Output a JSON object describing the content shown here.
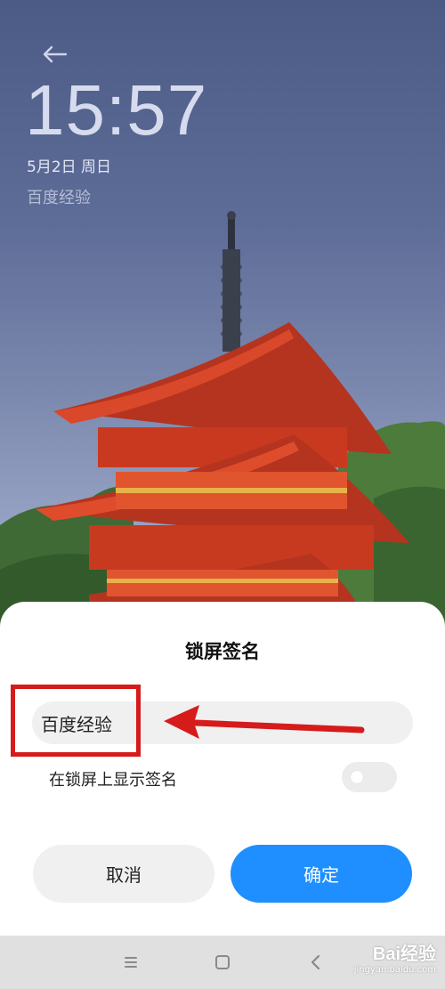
{
  "lockscreen": {
    "time": "15:57",
    "date": "5月2日 周日",
    "signature_preview": "百度经验"
  },
  "dialog": {
    "title": "锁屏签名",
    "signature_value": "百度经验",
    "toggle_label": "在锁屏上显示签名",
    "toggle_on": false,
    "cancel_label": "取消",
    "confirm_label": "确定"
  },
  "watermark": {
    "brand": "Bai经验",
    "url": "jingyan.baidu.com"
  },
  "colors": {
    "accent": "#1f8fff",
    "annotation": "#d61b1b"
  },
  "icons": {
    "back": "arrow-left-icon",
    "nav_menu": "menu-icon",
    "nav_home": "home-icon",
    "nav_back": "chevron-left-icon"
  }
}
